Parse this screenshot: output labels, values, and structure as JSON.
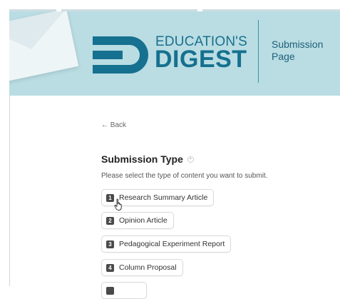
{
  "header": {
    "logo_top": "EDUCATION'S",
    "logo_bottom": "DIGEST",
    "page_label": "Submission Page"
  },
  "nav": {
    "back_label": "← Back"
  },
  "form": {
    "section_title": "Submission Type",
    "description": "Please select the type of content you want to submit.",
    "options": [
      {
        "num": "1",
        "label": "Research Summary Article"
      },
      {
        "num": "2",
        "label": "Opinion Article"
      },
      {
        "num": "3",
        "label": "Pedagogical Experiment Report"
      },
      {
        "num": "4",
        "label": "Column Proposal"
      }
    ]
  },
  "colors": {
    "brand": "#16708f",
    "banner": "#b9dde3"
  }
}
